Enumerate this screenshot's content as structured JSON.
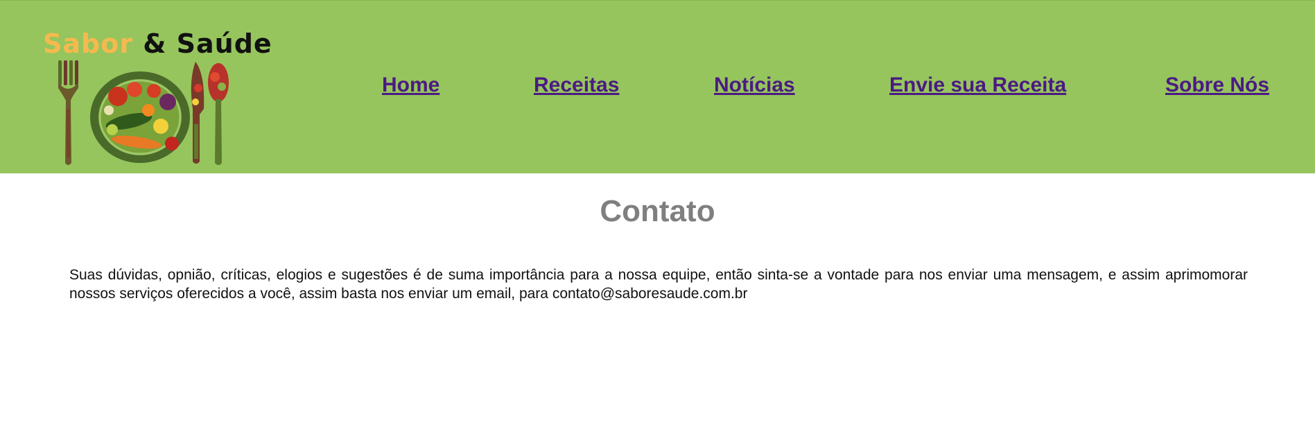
{
  "logo": {
    "word1": "Sabor",
    "ampersand": "&",
    "word2": "Saúde",
    "image_icon": "fork-plate-knife-spoon-vegetables-icon",
    "colors": {
      "word1": "#f6b94f",
      "word2": "#111111"
    }
  },
  "nav": {
    "items": [
      {
        "label": "Home"
      },
      {
        "label": "Receitas"
      },
      {
        "label": "Notícias"
      },
      {
        "label": "Envie sua Receita"
      },
      {
        "label": "Sobre Nós"
      }
    ]
  },
  "main": {
    "title": "Contato",
    "paragraph": "Suas dúvidas, opnião, críticas, elogios e sugestões é de suma importância para a nossa equipe, então sinta-se a vontade para nos enviar uma mensagem, e assim aprimomorar nossos serviços oferecidos a você, assim basta nos enviar um email, para contato@saboresaude.com.br"
  },
  "colors": {
    "header_bg": "#96c55d",
    "nav_link": "#4b1a84",
    "title": "#7f7f7f"
  }
}
